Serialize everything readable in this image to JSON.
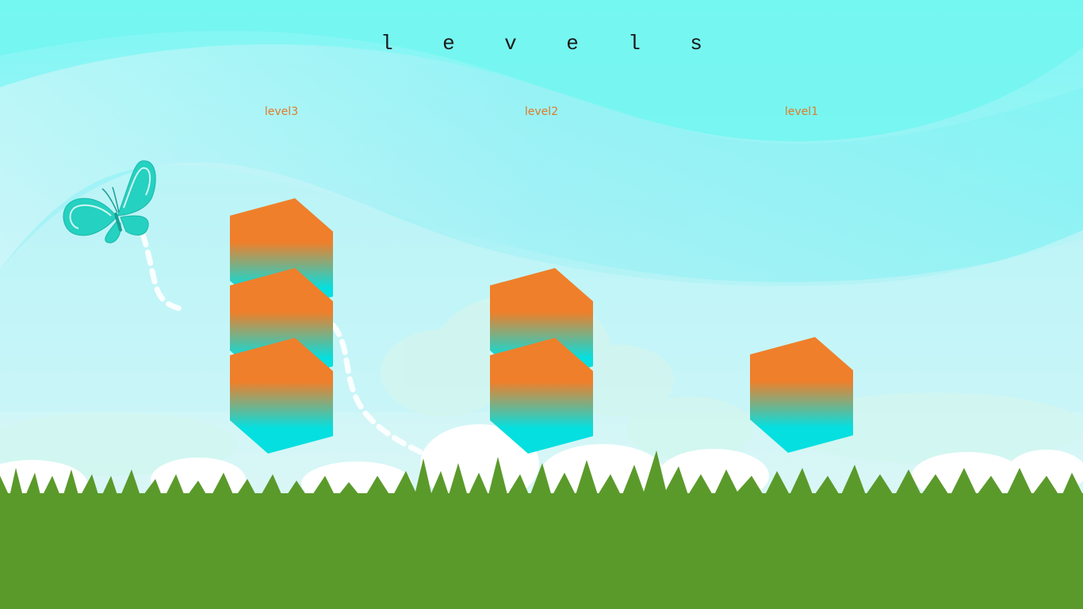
{
  "title": "l e v e l s",
  "levels": [
    {
      "label": "level3",
      "blocks": 3
    },
    {
      "label": "level2",
      "blocks": 2
    },
    {
      "label": "level1",
      "blocks": 1
    }
  ],
  "colors": {
    "cube_top": "#ef7f2a",
    "cube_bottom": "#05dfe0",
    "label": "#e07a2a",
    "grass": "#5a9a2a",
    "butterfly": "#25d1c0"
  },
  "decorations": [
    "butterfly-icon",
    "dashed-flight-path",
    "grass",
    "clouds"
  ]
}
